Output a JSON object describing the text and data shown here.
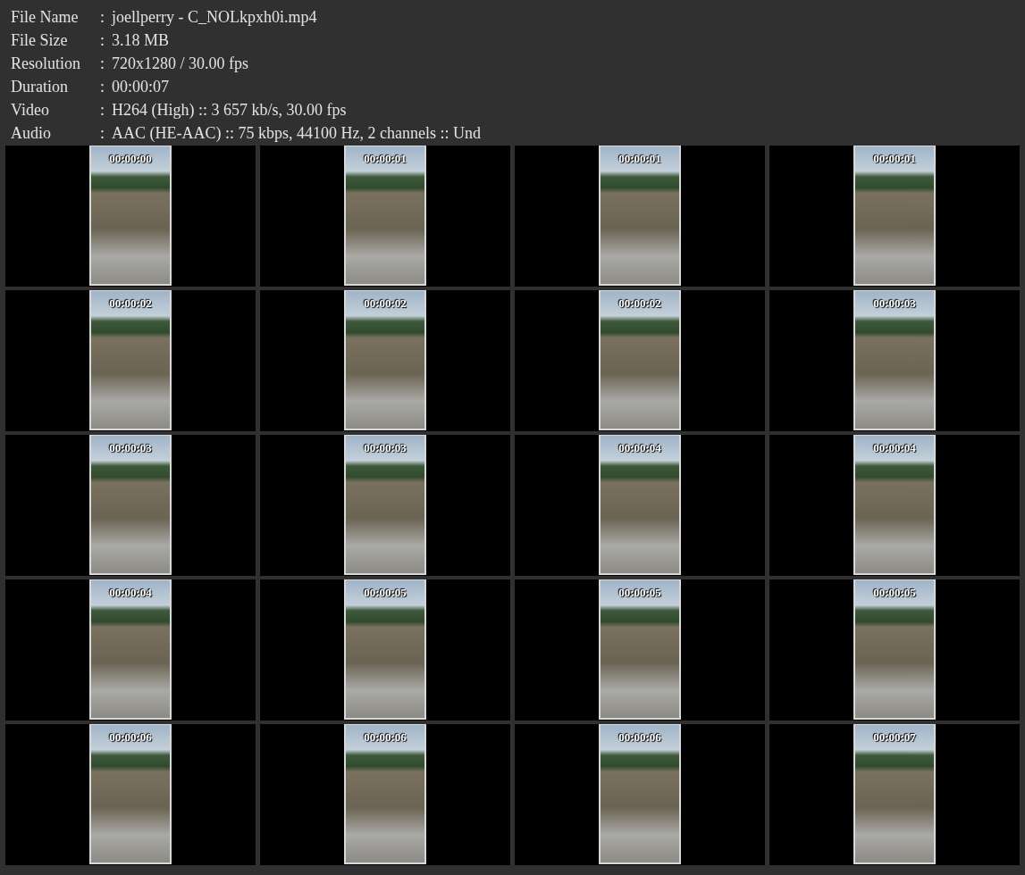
{
  "file_info": [
    {
      "label": "File Name",
      "separator": ":",
      "value": "joellperry - C_NOLkpxh0i.mp4"
    },
    {
      "label": "File Size",
      "separator": ":",
      "value": "3.18 MB"
    },
    {
      "label": "Resolution",
      "separator": ":",
      "value": "720x1280 / 30.00 fps"
    },
    {
      "label": "Duration",
      "separator": ":",
      "value": "00:00:07"
    },
    {
      "label": "Video",
      "separator": ":",
      "value": "H264 (High) :: 3 657 kb/s, 30.00 fps"
    },
    {
      "label": "Audio",
      "separator": ":",
      "value": "AAC (HE-AAC) :: 75 kbps, 44100 Hz, 2 channels :: Und"
    }
  ],
  "frames": [
    {
      "timestamp": "00:00:00"
    },
    {
      "timestamp": "00:00:01"
    },
    {
      "timestamp": "00:00:01"
    },
    {
      "timestamp": "00:00:01"
    },
    {
      "timestamp": "00:00:02"
    },
    {
      "timestamp": "00:00:02"
    },
    {
      "timestamp": "00:00:02"
    },
    {
      "timestamp": "00:00:03"
    },
    {
      "timestamp": "00:00:03"
    },
    {
      "timestamp": "00:00:03"
    },
    {
      "timestamp": "00:00:04"
    },
    {
      "timestamp": "00:00:04"
    },
    {
      "timestamp": "00:00:04"
    },
    {
      "timestamp": "00:00:05"
    },
    {
      "timestamp": "00:00:05"
    },
    {
      "timestamp": "00:00:05"
    },
    {
      "timestamp": "00:00:06"
    },
    {
      "timestamp": "00:00:06"
    },
    {
      "timestamp": "00:00:06"
    },
    {
      "timestamp": "00:00:07"
    }
  ]
}
